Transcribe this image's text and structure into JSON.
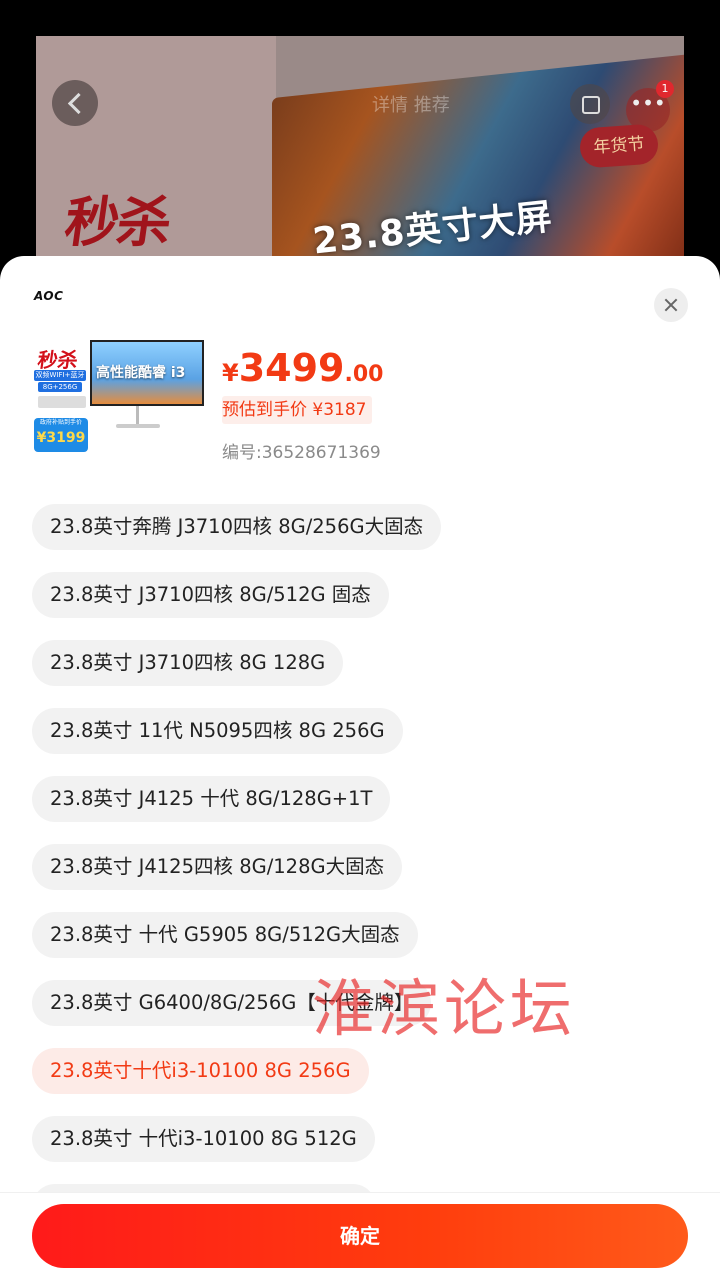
{
  "background": {
    "seckill_text": "秒杀",
    "headline": "23.8英寸大屏",
    "tabs_text": "详情  推荐",
    "more_badge": "1",
    "nianhuo": "年货节"
  },
  "sheet": {
    "brand": "AOC",
    "thumbnail": {
      "seckill": "秒杀",
      "chip1": "双频WIFI+蓝牙",
      "chip2": "8G+256G",
      "price_caption": "政府补贴到手价",
      "price_value": "¥3199",
      "screen_text": "高性能酷睿 i3"
    },
    "price": {
      "currency": "¥",
      "integer": "3499",
      "decimal": ".00"
    },
    "estimated_price": "预估到手价 ¥3187",
    "sku_number": "编号:36528671369",
    "options": [
      {
        "label": "23.8英寸奔腾 J3710四核 8G/256G大固态",
        "selected": false
      },
      {
        "label": "23.8英寸 J3710四核 8G/512G 固态",
        "selected": false
      },
      {
        "label": "23.8英寸  J3710四核  8G 128G",
        "selected": false
      },
      {
        "label": "23.8英寸 11代 N5095四核 8G 256G",
        "selected": false
      },
      {
        "label": "23.8英寸 J4125 十代 8G/128G+1T",
        "selected": false
      },
      {
        "label": "23.8英寸 J4125四核 8G/128G大固态",
        "selected": false
      },
      {
        "label": "23.8英寸  十代 G5905 8G/512G大固态",
        "selected": false
      },
      {
        "label": "23.8英寸 G6400/8G/256G【十代金牌】",
        "selected": false
      },
      {
        "label": "23.8英寸十代i3-10100  8G 256G",
        "selected": true
      },
      {
        "label": "23.8英寸  十代i3-10100 8G 512G",
        "selected": false
      }
    ],
    "confirm_label": "确定"
  },
  "watermark": "淮滨论坛",
  "colors": {
    "accent": "#f23a14",
    "button_start": "#ff1a1a",
    "button_end": "#ff5a1a",
    "chip_bg": "#f2f2f2"
  }
}
